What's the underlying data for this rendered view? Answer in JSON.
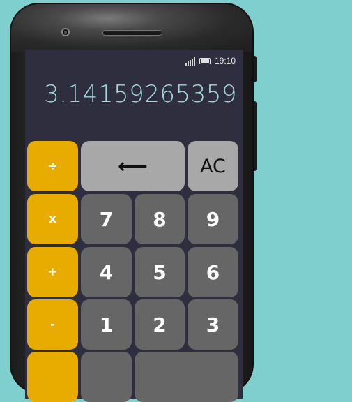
{
  "status_bar": {
    "time": "19:10",
    "signal_icon": "signal-bars-icon",
    "battery_icon": "battery-icon"
  },
  "display": {
    "value": "3.14159265359"
  },
  "keypad": {
    "row1": [
      {
        "label": "÷",
        "kind": "operator",
        "name": "divide-key"
      },
      {
        "label": "⟵",
        "kind": "function",
        "name": "backspace-key"
      },
      {
        "label": "AC",
        "kind": "function",
        "name": "all-clear-key"
      }
    ],
    "row2": [
      {
        "label": "x",
        "kind": "operator",
        "name": "multiply-key"
      },
      {
        "label": "7",
        "kind": "digit",
        "name": "digit-7-key"
      },
      {
        "label": "8",
        "kind": "digit",
        "name": "digit-8-key"
      },
      {
        "label": "9",
        "kind": "digit",
        "name": "digit-9-key"
      }
    ],
    "row3": [
      {
        "label": "+",
        "kind": "operator",
        "name": "add-key"
      },
      {
        "label": "4",
        "kind": "digit",
        "name": "digit-4-key"
      },
      {
        "label": "5",
        "kind": "digit",
        "name": "digit-5-key"
      },
      {
        "label": "6",
        "kind": "digit",
        "name": "digit-6-key"
      }
    ],
    "row4": [
      {
        "label": "-",
        "kind": "operator",
        "name": "subtract-key"
      },
      {
        "label": "1",
        "kind": "digit",
        "name": "digit-1-key"
      },
      {
        "label": "2",
        "kind": "digit",
        "name": "digit-2-key"
      },
      {
        "label": "3",
        "kind": "digit",
        "name": "digit-3-key"
      }
    ]
  },
  "colors": {
    "background": "#7ecfcd",
    "screen": "#2f2e3f",
    "display_text": "#9fd8dc",
    "operator_key": "#e8ab00",
    "digit_key": "#666666",
    "function_key": "#a8a8a8"
  }
}
